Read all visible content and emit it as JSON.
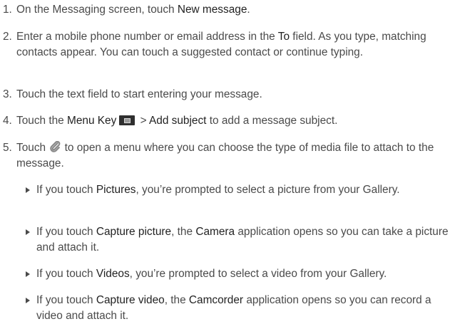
{
  "steps": [
    {
      "num": "1.",
      "pre": "On the Messaging screen, touch ",
      "b1": "New message",
      "post": "."
    },
    {
      "num": "2.",
      "pre": "Enter a mobile phone number or email address in the ",
      "b1": "To",
      "post": " field. As you type, matching contacts appear. You can touch a suggested contact or continue typing."
    },
    {
      "num": "3.",
      "text": "Touch the text field to start entering your message."
    },
    {
      "num": "4.",
      "pre": "Touch the ",
      "b1": "Menu Key",
      "mid": " > ",
      "b2": "Add subject",
      "post": " to add a message subject."
    },
    {
      "num": "5.",
      "pre": "Touch ",
      "post": " to open a menu where you can choose the type of media file to attach to the message."
    }
  ],
  "bullets": [
    {
      "pre": "If you touch ",
      "b1": "Pictures",
      "post": ", you’re prompted to select a picture from your Gallery."
    },
    {
      "pre": "If you touch ",
      "b1": "Capture picture",
      "mid": ", the ",
      "b2": "Camera",
      "post": " application opens so you can take a picture and attach it."
    },
    {
      "pre": "If you touch ",
      "b1": "Videos",
      "post": ", you’re prompted to select a video from your Gallery."
    },
    {
      "pre": "If you touch ",
      "b1": "Capture video",
      "mid": ", the ",
      "b2": "Camcorder",
      "post": " application opens so you can record a video and attach it."
    }
  ],
  "icons": {
    "menu_key": "menu-key-icon",
    "attach": "paperclip-icon"
  }
}
